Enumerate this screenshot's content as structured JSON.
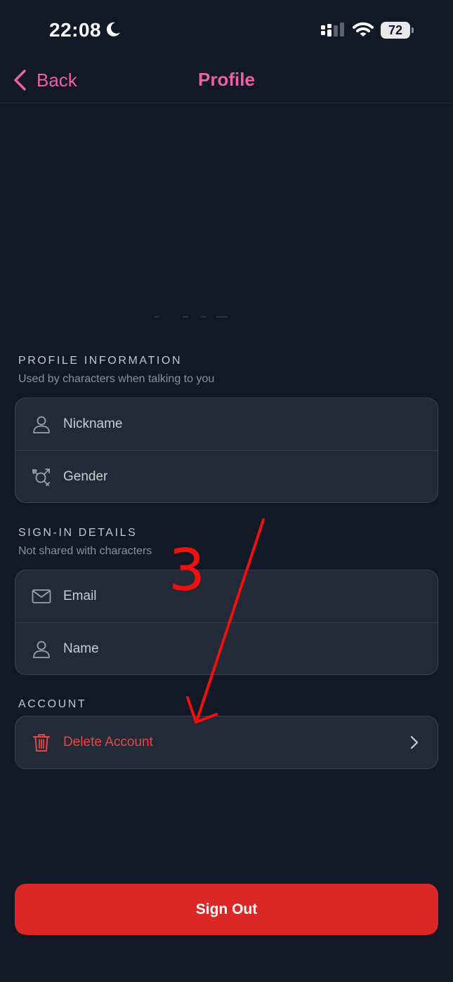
{
  "status_bar": {
    "time": "22:08",
    "battery": "72",
    "icons": [
      "moon-icon",
      "cellular-signal-icon",
      "wifi-icon",
      "battery-icon"
    ]
  },
  "nav": {
    "back_label": "Back",
    "title": "Profile"
  },
  "profile_info": {
    "title": "PROFILE INFORMATION",
    "subtitle": "Used by characters when talking to you",
    "rows": [
      {
        "label": "Nickname",
        "icon": "person-icon"
      },
      {
        "label": "Gender",
        "icon": "gender-icon"
      }
    ]
  },
  "sign_in": {
    "title": "SIGN-IN DETAILS",
    "subtitle": "Not shared with characters",
    "rows": [
      {
        "label": "Email",
        "icon": "envelope-icon"
      },
      {
        "label": "Name",
        "icon": "person-icon"
      }
    ]
  },
  "account": {
    "title": "ACCOUNT",
    "rows": [
      {
        "label": "Delete Account",
        "icon": "trash-icon",
        "chevron": "chevron-right-icon"
      }
    ]
  },
  "sign_out_label": "Sign Out",
  "annotation": {
    "number": "3",
    "color": "#f01010"
  },
  "colors": {
    "background": "#121826",
    "accent": "#ef5fa7",
    "card": "#222a38",
    "danger": "#e54646",
    "sign_out": "#dc2727"
  }
}
